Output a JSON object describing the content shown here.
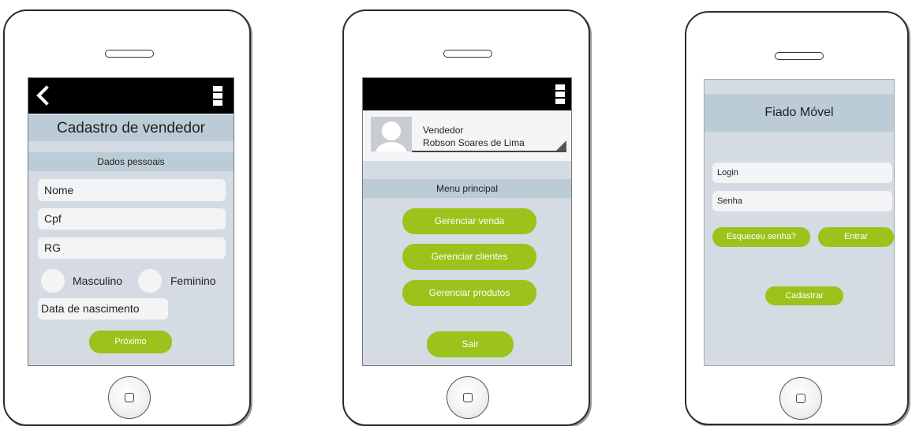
{
  "colors": {
    "screen_bg": "#d5dbe2",
    "header_band": "#bcccd6",
    "top_bar": "#000000",
    "field_bg": "#f3f4f6",
    "button_green": "#9bc31c",
    "button_text": "#ffffff"
  },
  "phone1": {
    "title": "Cadastro de vendedor",
    "section": "Dados pessoais",
    "fields": {
      "nome": "Nome",
      "cpf": "Cpf",
      "rg": "RG",
      "data_nascimento": "Data de nascimento"
    },
    "radio": {
      "masculino": "Masculino",
      "feminino": "Feminino"
    },
    "next_button": "Próximo"
  },
  "phone2": {
    "profile": {
      "role": "Vendedor",
      "name": "Robson Soares de Lima"
    },
    "menu_title": "Menu principal",
    "buttons": {
      "vendas": "Gerenciar venda",
      "clientes": "Gerenciar clientes",
      "produtos": "Gerenciar produtos",
      "sair": "Sair"
    }
  },
  "phone3": {
    "title": "Fiado Móvel",
    "login_field": "Login",
    "senha_field": "Senha",
    "forgot_button": "Esqueceu senha?",
    "enter_button": "Entrar",
    "register_button": "Cadastrar"
  }
}
